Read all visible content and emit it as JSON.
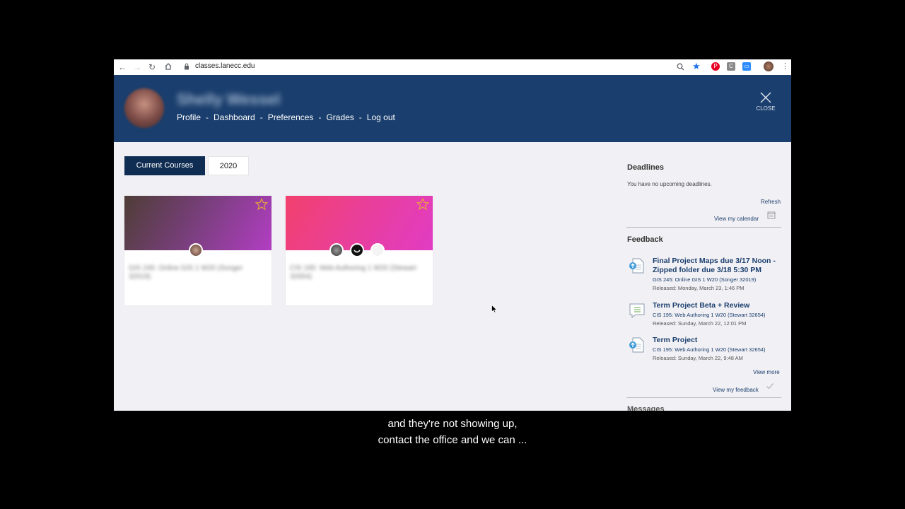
{
  "browser": {
    "url": "classes.lanecc.edu",
    "icons": [
      "back-icon",
      "forward-icon",
      "reload-icon",
      "home-icon",
      "lock-icon",
      "zoom-icon",
      "bookmark-star-icon",
      "pinterest-icon",
      "extension-c-icon",
      "zoom-video-icon",
      "profile-avatar-icon",
      "kebab-menu-icon"
    ]
  },
  "header": {
    "username": "Shelly Wessel",
    "nav": [
      "Profile",
      "Dashboard",
      "Preferences",
      "Grades",
      "Log out"
    ],
    "close_label": "CLOSE",
    "bg_color": "#1a3e6d"
  },
  "tabs": [
    {
      "label": "Current Courses",
      "active": true
    },
    {
      "label": "2020",
      "active": false
    }
  ],
  "courses": [
    {
      "blurred_title": "GIS 245: Online GIS 1 W20 (Songer 32019)",
      "colors": [
        "#4e3d36",
        "#b23ec3"
      ]
    },
    {
      "blurred_title": "CIS 195: Web Authoring 1 W20 (Stewart 32654)",
      "colors": [
        "#f2416d",
        "#e13cc4"
      ]
    }
  ],
  "deadlines": {
    "title": "Deadlines",
    "empty_text": "You have no upcoming deadlines.",
    "refresh": "Refresh",
    "calendar_link": "View my calendar"
  },
  "feedback": {
    "title": "Feedback",
    "items": [
      {
        "title": "Final Project Maps due 3/17 Noon - Zipped folder due 3/18 5:30 PM",
        "course": "GIS 245: Online GIS 1 W20 (Songer 32019)",
        "released": "Released: Monday, March 23, 1:46 PM",
        "icon": "assignment-upload-icon"
      },
      {
        "title": "Term Project Beta + Review",
        "course": "CIS 195: Web Authoring 1 W20 (Stewart 32654)",
        "released": "Released: Sunday, March 22, 12:01 PM",
        "icon": "comment-feedback-icon"
      },
      {
        "title": "Term Project",
        "course": "CIS 195: Web Authoring 1 W20 (Stewart 32654)",
        "released": "Released: Sunday, March 22, 9:48 AM",
        "icon": "assignment-upload-icon"
      }
    ],
    "view_more": "View more",
    "view_feedback": "View my feedback"
  },
  "messages_title": "Messages",
  "subtitles": [
    "and they're not showing up,",
    "contact the office and we can ..."
  ]
}
